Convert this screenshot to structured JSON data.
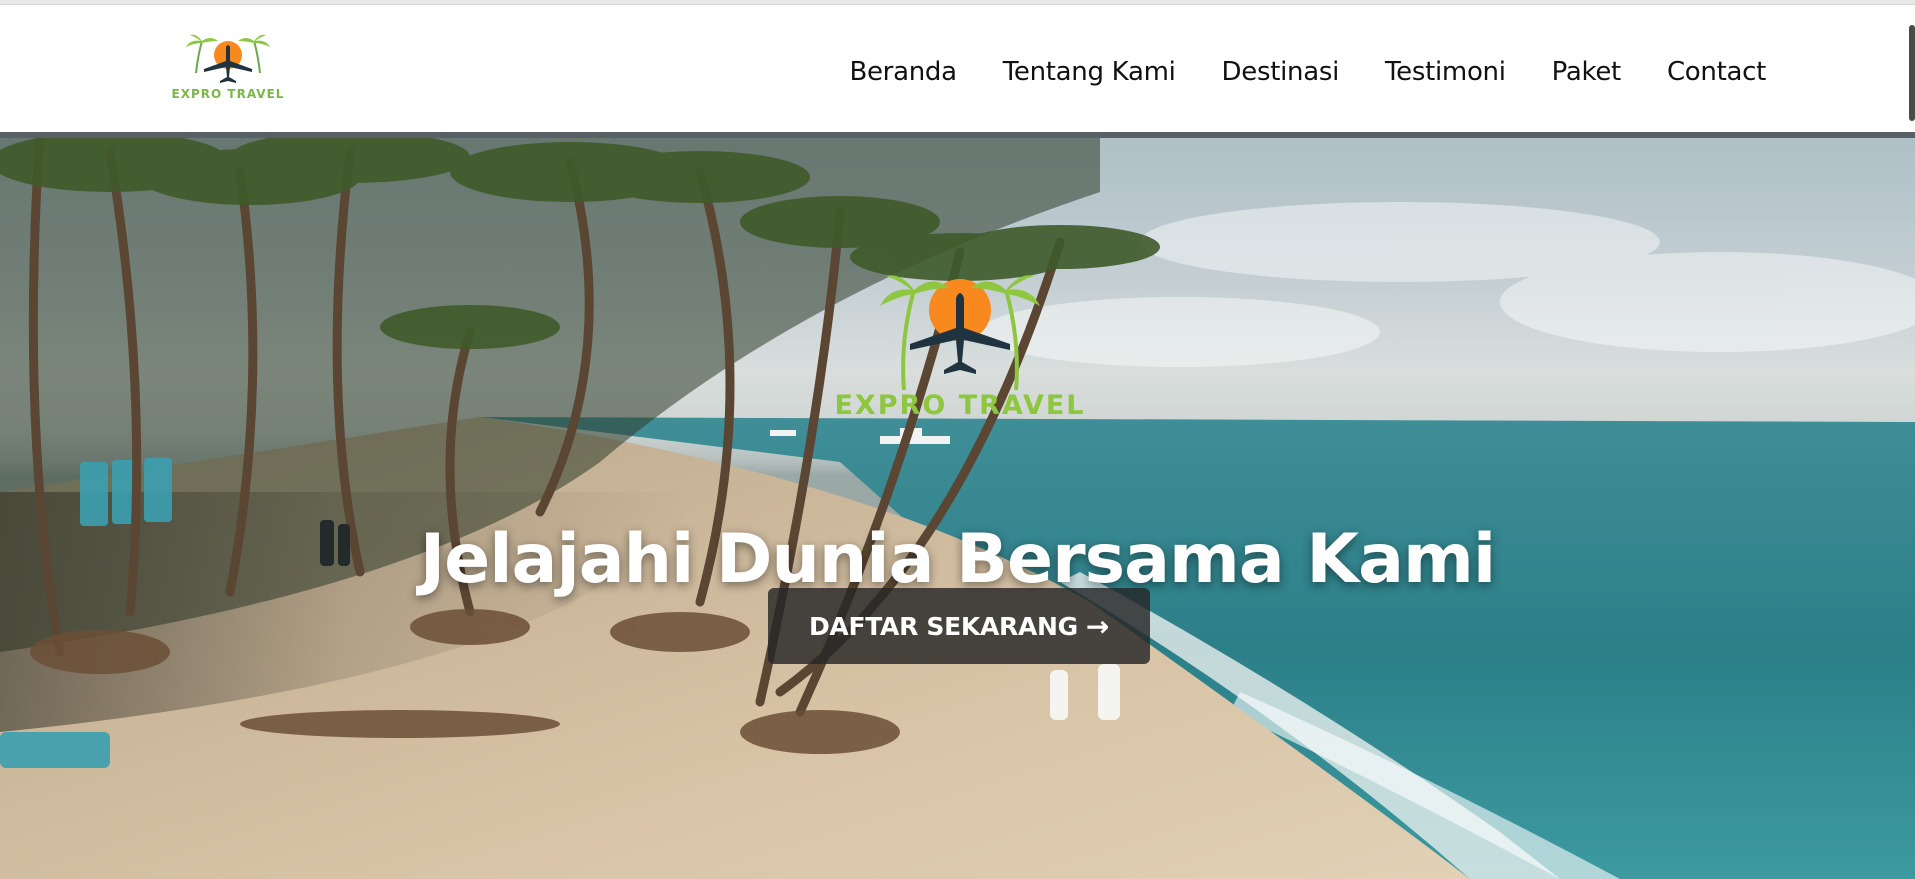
{
  "brand": {
    "name": "EXPRO TRAVEL",
    "logo_icon": "airplane-sun-palms-logo",
    "sun_color": "#f7891f",
    "palm_color": "#8ec63f",
    "text_color": "#7ab648"
  },
  "nav": {
    "items": [
      {
        "label": "Beranda"
      },
      {
        "label": "Tentang Kami"
      },
      {
        "label": "Destinasi"
      },
      {
        "label": "Testimoni"
      },
      {
        "label": "Paket"
      },
      {
        "label": "Contact"
      }
    ]
  },
  "hero": {
    "logo_text": "EXPRO TRAVEL",
    "headline": "Jelajahi Dunia Bersama Kami",
    "cta_label": "DAFTAR SEKARANG",
    "cta_icon": "arrow-right-icon"
  }
}
